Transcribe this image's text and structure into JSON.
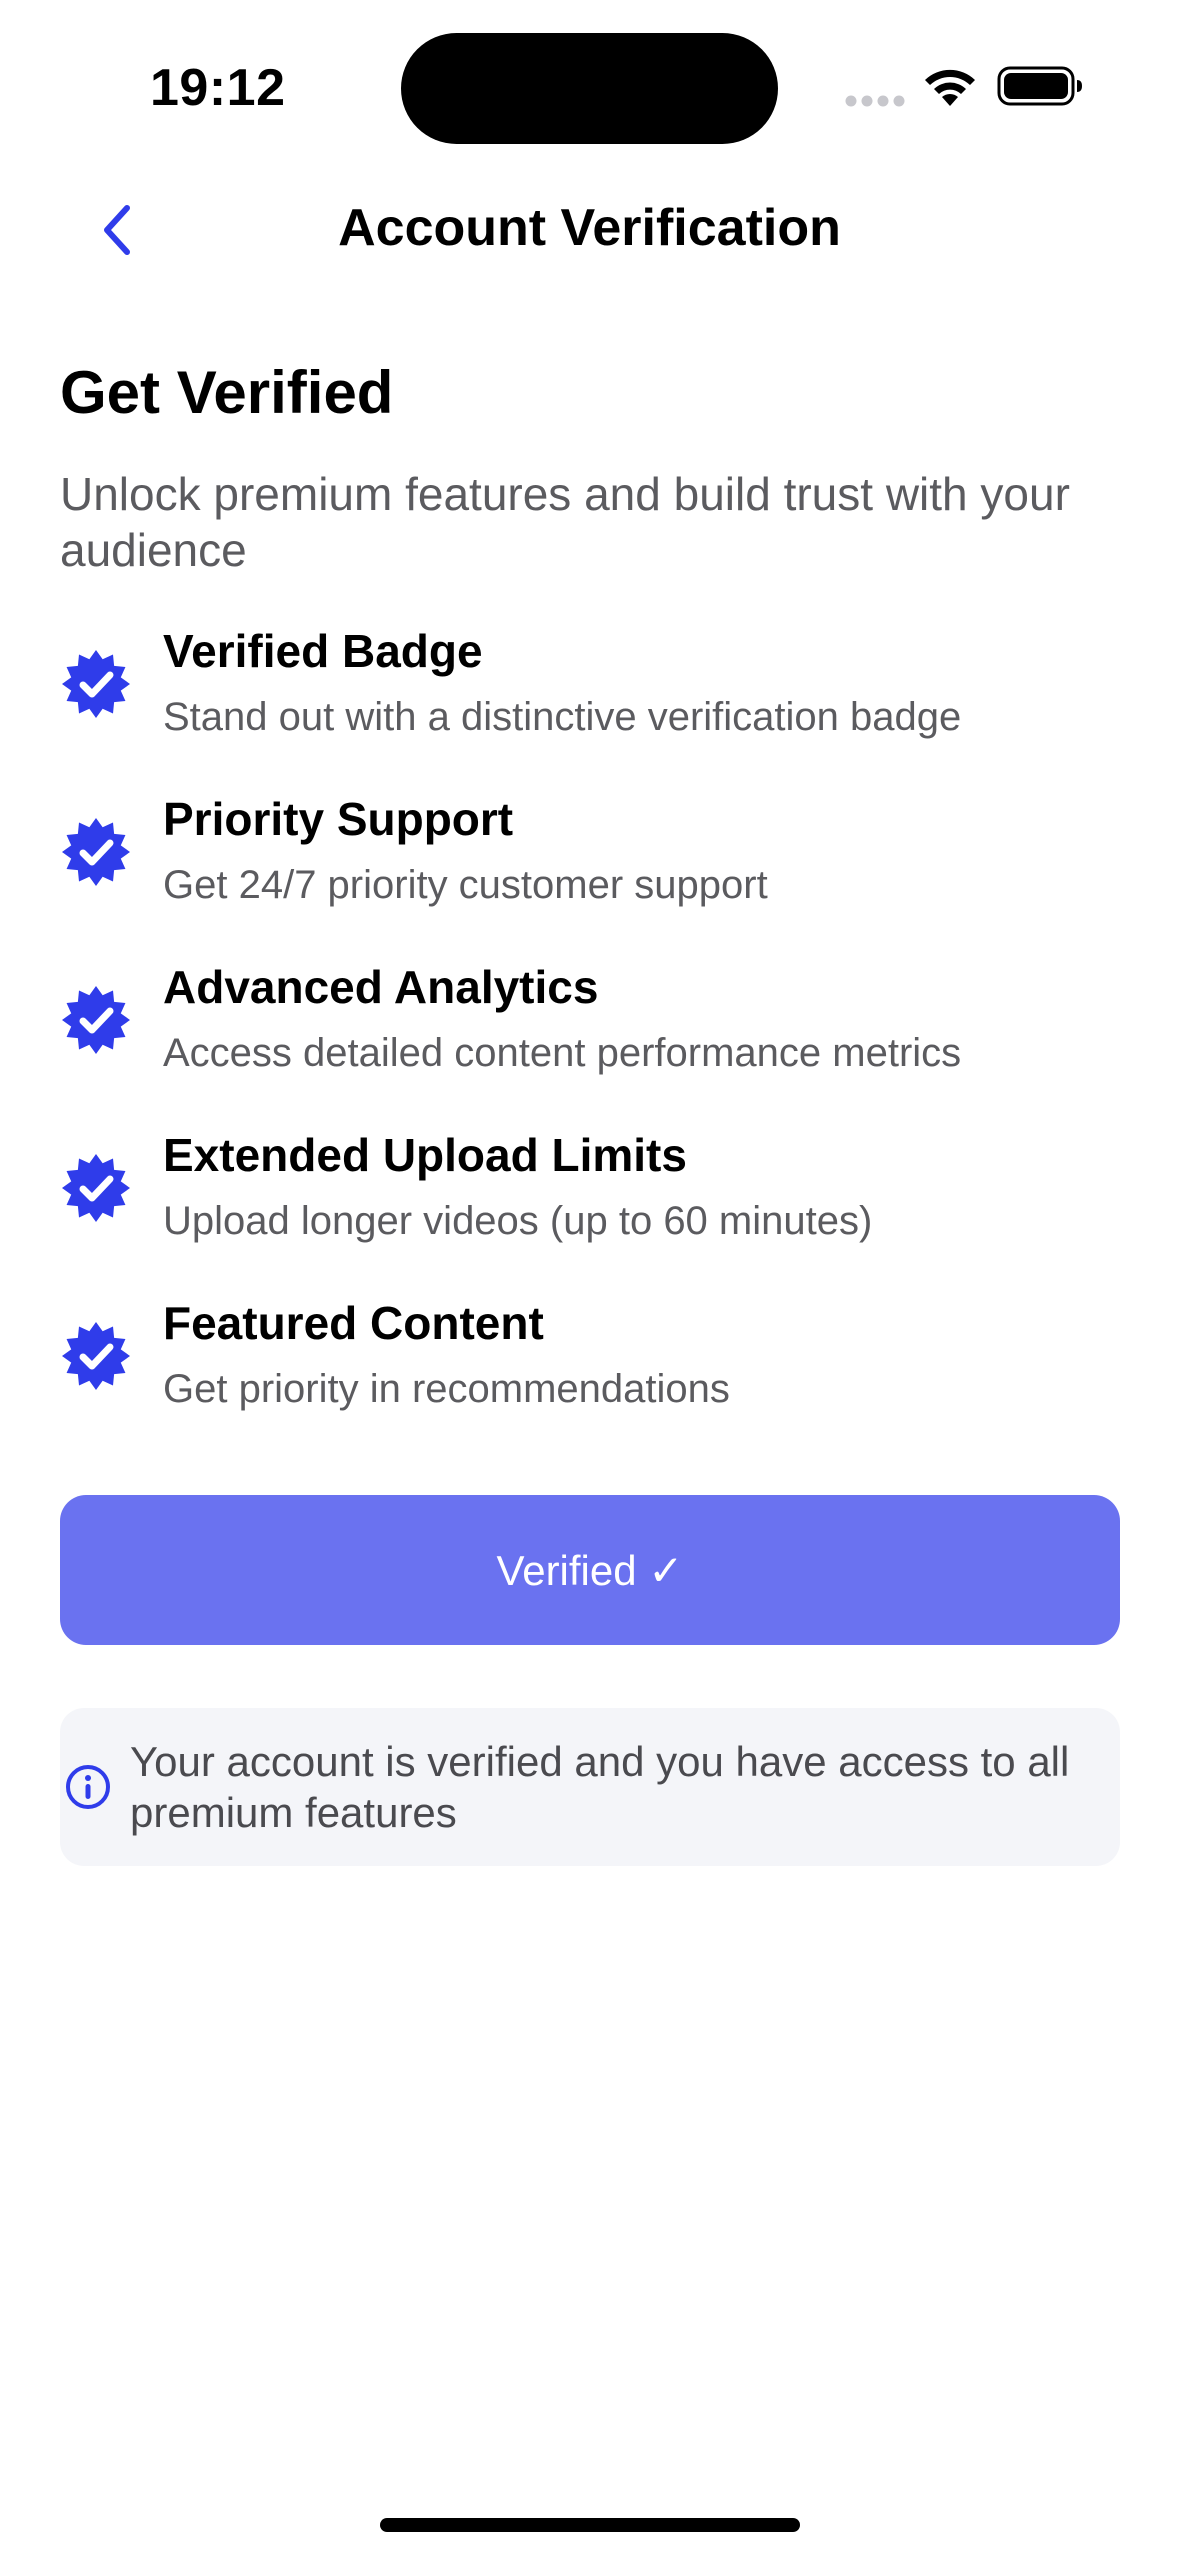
{
  "status_bar": {
    "time": "19:12"
  },
  "nav": {
    "title": "Account Verification",
    "back_icon": "chevron-left-icon"
  },
  "header": {
    "title": "Get Verified",
    "subtitle": "Unlock premium features and build trust with your audience"
  },
  "features": [
    {
      "title": "Verified Badge",
      "description": "Stand out with a distinctive verification badge",
      "icon": "verified-seal-icon"
    },
    {
      "title": "Priority Support",
      "description": "Get 24/7 priority customer support",
      "icon": "verified-seal-icon"
    },
    {
      "title": "Advanced Analytics",
      "description": "Access detailed content performance metrics",
      "icon": "verified-seal-icon"
    },
    {
      "title": "Extended Upload Limits",
      "description": "Upload longer videos (up to 60 minutes)",
      "icon": "verified-seal-icon"
    },
    {
      "title": "Featured Content",
      "description": "Get priority in recommendations",
      "icon": "verified-seal-icon"
    }
  ],
  "action_button": {
    "label": "Verified ✓"
  },
  "info": {
    "icon": "info-icon",
    "text": "Your account is verified and you have access to all premium features"
  },
  "colors": {
    "accent": "#2f3cea",
    "button": "#6a72f0",
    "info_bg": "#f4f5f9",
    "secondary_text": "#5b5b5f"
  }
}
